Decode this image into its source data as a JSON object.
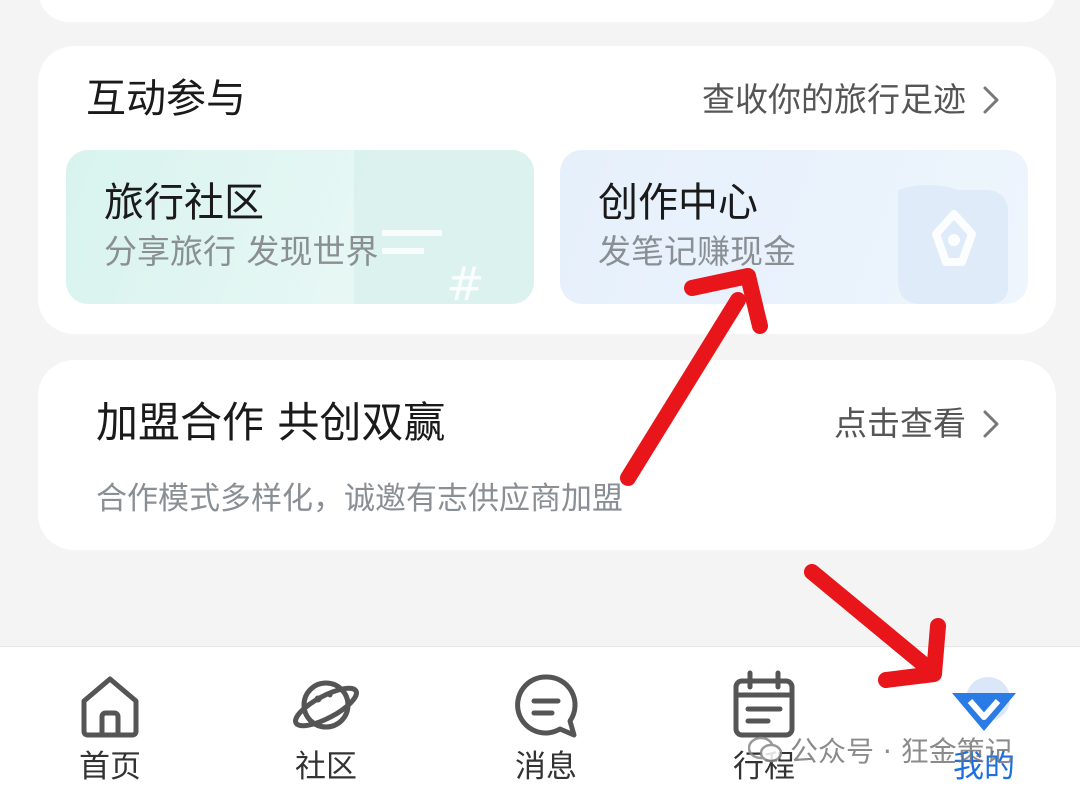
{
  "interact": {
    "title": "互动参与",
    "link": "查收你的旅行足迹",
    "tiles": [
      {
        "title": "旅行社区",
        "subtitle": "分享旅行 发现世界"
      },
      {
        "title": "创作中心",
        "subtitle": "发笔记赚现金"
      }
    ]
  },
  "join": {
    "title": "加盟合作 共创双赢",
    "link": "点击查看",
    "subtitle": "合作模式多样化，诚邀有志供应商加盟"
  },
  "tabbar": {
    "items": [
      {
        "label": "首页",
        "icon": "home-icon"
      },
      {
        "label": "社区",
        "icon": "planet-icon"
      },
      {
        "label": "消息",
        "icon": "chat-bubble-icon"
      },
      {
        "label": "行程",
        "icon": "calendar-icon"
      },
      {
        "label": "我的",
        "icon": "profile-logo-icon",
        "active": true
      }
    ]
  },
  "watermark": {
    "text": "公众号 · 狂金策记"
  },
  "colors": {
    "accent": "#1d6fe0",
    "annotation_arrow": "#e8151b"
  }
}
